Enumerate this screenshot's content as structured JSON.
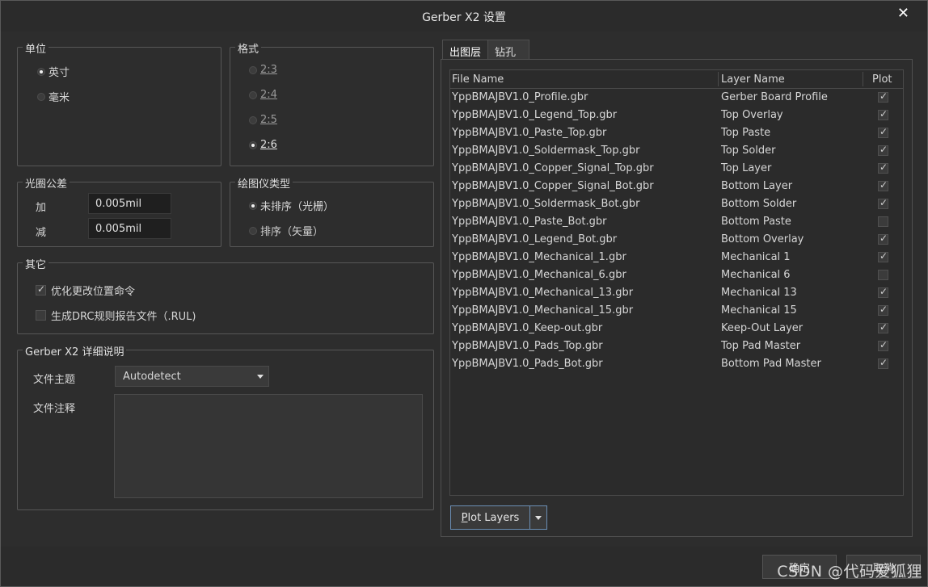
{
  "window": {
    "title": "Gerber X2 设置",
    "close_glyph": "✕"
  },
  "units": {
    "group_title": "单位",
    "options": [
      {
        "label": "英寸",
        "selected": true
      },
      {
        "label": "毫米",
        "selected": false
      }
    ]
  },
  "format": {
    "group_title": "格式",
    "options": [
      {
        "label": "2:3",
        "selected": false
      },
      {
        "label": "2:4",
        "selected": false
      },
      {
        "label": "2:5",
        "selected": false
      },
      {
        "label": "2:6",
        "selected": true
      }
    ]
  },
  "aperture": {
    "group_title": "光圈公差",
    "plus_label": "加",
    "plus_value": "0.005mil",
    "minus_label": "减",
    "minus_value": "0.005mil"
  },
  "plotter": {
    "group_title": "绘图仪类型",
    "options": [
      {
        "label": "未排序（光栅）",
        "selected": true
      },
      {
        "label": "排序（矢量）",
        "selected": false
      }
    ]
  },
  "other": {
    "group_title": "其它",
    "options": [
      {
        "label": "优化更改位置命令",
        "checked": true
      },
      {
        "label": "生成DRC规则报告文件（.RUL)",
        "checked": false
      }
    ]
  },
  "x2_details": {
    "group_title": "Gerber X2 详细说明",
    "subject_label": "文件主题",
    "subject_value": "Autodetect",
    "comment_label": "文件注释"
  },
  "tabs": [
    {
      "label": "出图层",
      "active": true
    },
    {
      "label": "钻孔",
      "active": false
    }
  ],
  "layers_table": {
    "columns": [
      "File Name",
      "Layer Name",
      "Plot"
    ],
    "rows": [
      {
        "file": "YppBMAJBV1.0_Profile.gbr",
        "layer": "Gerber Board Profile",
        "plot": true
      },
      {
        "file": "YppBMAJBV1.0_Legend_Top.gbr",
        "layer": "Top Overlay",
        "plot": true
      },
      {
        "file": "YppBMAJBV1.0_Paste_Top.gbr",
        "layer": "Top Paste",
        "plot": true
      },
      {
        "file": "YppBMAJBV1.0_Soldermask_Top.gbr",
        "layer": "Top Solder",
        "plot": true
      },
      {
        "file": "YppBMAJBV1.0_Copper_Signal_Top.gbr",
        "layer": "Top Layer",
        "plot": true
      },
      {
        "file": "YppBMAJBV1.0_Copper_Signal_Bot.gbr",
        "layer": "Bottom Layer",
        "plot": true
      },
      {
        "file": "YppBMAJBV1.0_Soldermask_Bot.gbr",
        "layer": "Bottom Solder",
        "plot": true
      },
      {
        "file": "YppBMAJBV1.0_Paste_Bot.gbr",
        "layer": "Bottom Paste",
        "plot": false
      },
      {
        "file": "YppBMAJBV1.0_Legend_Bot.gbr",
        "layer": "Bottom Overlay",
        "plot": true
      },
      {
        "file": "YppBMAJBV1.0_Mechanical_1.gbr",
        "layer": "Mechanical 1",
        "plot": true
      },
      {
        "file": "YppBMAJBV1.0_Mechanical_6.gbr",
        "layer": "Mechanical 6",
        "plot": false
      },
      {
        "file": "YppBMAJBV1.0_Mechanical_13.gbr",
        "layer": "Mechanical 13",
        "plot": true
      },
      {
        "file": "YppBMAJBV1.0_Mechanical_15.gbr",
        "layer": "Mechanical 15",
        "plot": true
      },
      {
        "file": "YppBMAJBV1.0_Keep-out.gbr",
        "layer": "Keep-Out Layer",
        "plot": true
      },
      {
        "file": "YppBMAJBV1.0_Pads_Top.gbr",
        "layer": "Top Pad Master",
        "plot": true
      },
      {
        "file": "YppBMAJBV1.0_Pads_Bot.gbr",
        "layer": "Bottom Pad Master",
        "plot": true
      }
    ]
  },
  "plot_layers_button": {
    "label": "Plot Layers",
    "mnemonic": "P",
    "rest": "lot Layers"
  },
  "footer": {
    "ok_label": "确定",
    "cancel_label": "取消",
    "watermark": "CSDN @代码爱狐狸"
  }
}
